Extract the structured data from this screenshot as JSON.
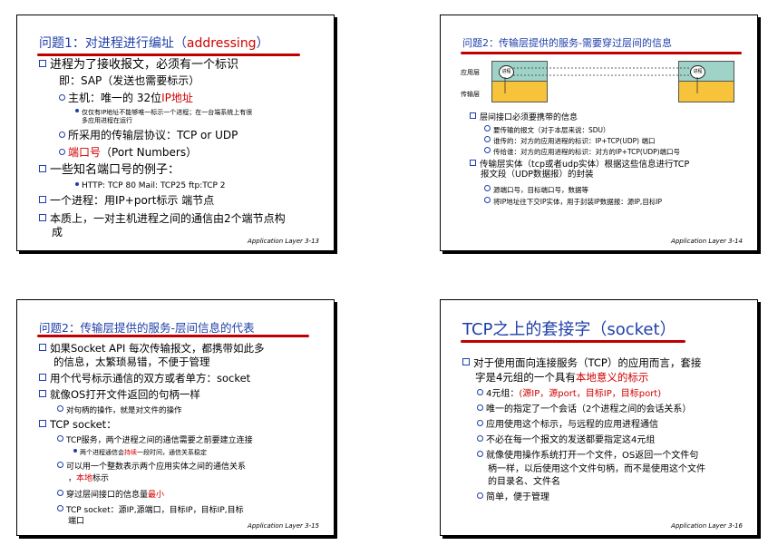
{
  "slides": [
    {
      "title_prefix": "问题1：对进程进行编址（",
      "title_en": "addressing",
      "title_suffix": "）",
      "lines": [
        "进程为了接收报文，必须有一个标识",
        "即：SAP（发送也需要标示）",
        "主机：唯一的 32位",
        "IP地址",
        "仅仅有IP地址不能够唯一标示一个进程；在一台端系统上有很",
        "多应用进程在运行",
        "所采用的传输层协议：TCP or UDP",
        "端口号",
        "（Port Numbers）",
        "一些知名端口号的例子：",
        "HTTP: TCP 80 Mail: TCP25 ftp:TCP 2",
        "一个进程：用IP+port标示 端节点",
        "本质上，一对主机进程之间的通信由2个端节点构",
        "成"
      ],
      "footer": "Application Layer    3-13"
    },
    {
      "title": "问题2：传输层提供的服务-需要穿过层间的信息",
      "diagram": {
        "app_label": "应用层",
        "transport_label": "传输层",
        "process_label": "进程"
      },
      "lines": [
        "层间接口必须要携带的信息",
        "要传输的报文（对于本层来说：SDU）",
        "谁传的：对方的应用进程的标识：IP+TCP(UDP) 端口",
        "传给谁：对方的应用进程的标识：对方的IP+TCP(UDP)端口号",
        "传输层实体（tcp或者udp实体）根据这些信息进行TCP",
        "报文段（UDP数据报）的封装",
        "源端口号，目标端口号，数据等",
        "将IP地址往下交IP实体，用于封装IP数据报：源IP,目标IP"
      ],
      "footer": "Application Layer    3-14"
    },
    {
      "title": "问题2：传输层提供的服务-层间信息的代表",
      "lines": [
        "如果Socket API 每次传输报文，都携带如此多",
        "的信息，太繁琐易错，不便于管理",
        "用个代号标示通信的双方或者单方：socket",
        "就像OS打开文件返回的句柄一样",
        "对句柄的操作，就是对文件的操作",
        "TCP socket：",
        "TCP服务，两个进程之间的通信需要之前要建立连接",
        "两个进程通信会",
        "持续",
        "一段时间，通信关系稳定",
        "可以用一个整数表示两个应用实体之间的通信关系",
        "，",
        "本地",
        "标示",
        "穿过层间接口的信息量",
        "最小",
        "TCP socket：源IP,源端口，目标IP，目标IP,目标",
        "端口"
      ],
      "footer": "Application Layer    3-15"
    },
    {
      "title": "TCP之上的套接字（socket）",
      "lines": [
        "对于使用面向连接服务（TCP）的应用而言，套接",
        "字是4元组的一个具有",
        "本地意义的标示",
        "4元组：",
        "(源IP，源port，目标IP，目标port)",
        "唯一的指定了一个会话（2个进程之间的会话关系）",
        "应用使用这个标示，与远程的应用进程通信",
        "不必在每一个报文的发送都要指定这4元组",
        "就像使用操作系统打开一个文件，OS返回一个文件句",
        "柄一样，以后使用这个文件句柄，而不是使用这个文件",
        "的目录名、文件名",
        "简单，便于管理"
      ],
      "footer": "Application Layer    3-16"
    }
  ]
}
